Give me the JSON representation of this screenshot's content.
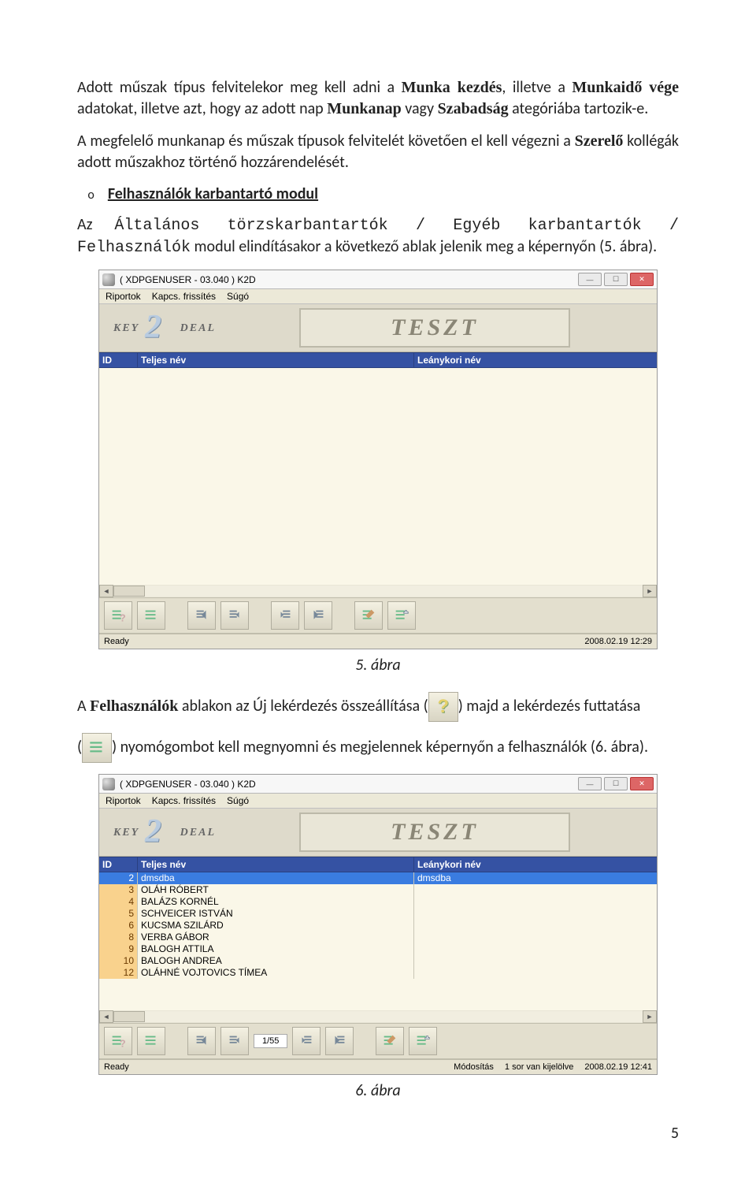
{
  "para1": {
    "t1": "Adott műszak típus felvitelekor meg kell adni a ",
    "b1": "Munka kezdés",
    "t2": ", illetve a ",
    "b2": "Munkaidő vége",
    "t3": " adatokat, illetve azt, hogy az adott nap ",
    "b3": "Munkanap",
    "t4": " vagy ",
    "b4": "Szabadság",
    "t5": " ategóriába tartozik-e."
  },
  "para2": {
    "t1": "A megfelelő munkanap és műszak típusok felvitelét követően el kell végezni a ",
    "b1": "Szerelő",
    "t2": " kollégák adott műszakhoz történő hozzárendelését."
  },
  "bullet": {
    "mark": "o",
    "label": "Felhasználók karbantartó modul"
  },
  "para3": {
    "t1": "Az ",
    "m1": "Általános törzskarbantartók / Egyéb karbantartók / Felhasználók",
    "t2": " modul elindításakor a következő ablak jelenik meg a képernyőn (5. ábra)."
  },
  "shot1": {
    "title": "( XDPGENUSER - 03.040 )     K2D",
    "menu": [
      "Riportok",
      "Kapcs. frissítés",
      "Súgó"
    ],
    "brand": "TESZT",
    "cols": {
      "c1": "ID",
      "c2": "Teljes név",
      "c3": "Leánykori név"
    },
    "status_left": "Ready",
    "status_right": "2008.02.19 12:29"
  },
  "caption1": "5. ábra",
  "para4": {
    "t1": "A ",
    "b1": "Felhasználók",
    "t2": " ablakon az Új lekérdezés összeállítása (",
    "t3": ") majd a lekérdezés futtatása"
  },
  "para5": {
    "t1": "(",
    "t2": ") nyomógombot kell megnyomni és megjelennek képernyőn a felhasználók (6. ábra)."
  },
  "shot2": {
    "title": "( XDPGENUSER - 03.040 )     K2D",
    "menu": [
      "Riportok",
      "Kapcs. frissítés",
      "Súgó"
    ],
    "brand": "TESZT",
    "cols": {
      "c1": "ID",
      "c2": "Teljes név",
      "c3": "Leánykori név"
    },
    "rows": [
      {
        "id": "2",
        "name": "dmsdba",
        "maiden": "dmsdba",
        "sel": true
      },
      {
        "id": "3",
        "name": "OLÁH RÓBERT",
        "maiden": ""
      },
      {
        "id": "4",
        "name": "BALÁZS KORNÉL",
        "maiden": ""
      },
      {
        "id": "5",
        "name": "SCHVEICER ISTVÁN",
        "maiden": ""
      },
      {
        "id": "6",
        "name": "KUCSMA SZILÁRD",
        "maiden": ""
      },
      {
        "id": "8",
        "name": "VERBA GÁBOR",
        "maiden": ""
      },
      {
        "id": "9",
        "name": "BALOGH ATTILA",
        "maiden": ""
      },
      {
        "id": "10",
        "name": "BALOGH ANDREA",
        "maiden": ""
      },
      {
        "id": "12",
        "name": "OLÁHNÉ VOJTOVICS TÍMEA",
        "maiden": ""
      }
    ],
    "page": "1/55",
    "status_left": "Ready",
    "status_mid1": "Módosítás",
    "status_mid2": "1 sor van kijelölve",
    "status_right": "2008.02.19 12:41"
  },
  "caption2": "6. ábra",
  "pagenum": "5"
}
